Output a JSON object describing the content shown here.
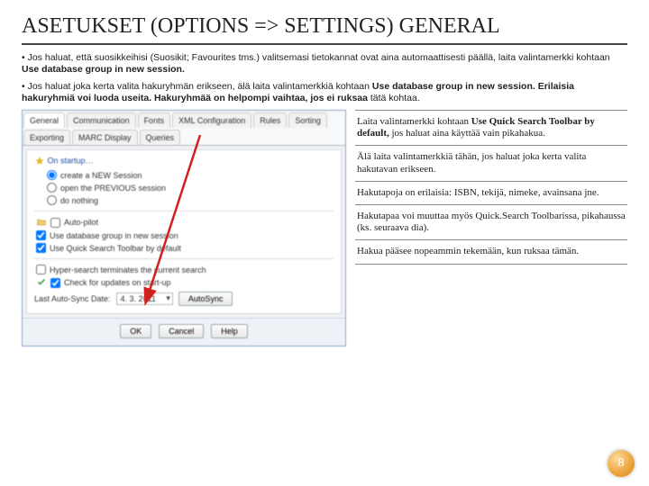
{
  "title": "ASETUKSET (OPTIONS => SETTINGS) GENERAL",
  "bullets": {
    "p1a": "• Jos haluat, että suosikkeihisi (Suosikit; Favourites tms.) valitsemasi tietokannat ovat aina automaattisesti päällä, laita valintamerkki kohtaan ",
    "p1b": "Use database group in new session.",
    "p2a": "• Jos haluat joka kerta valita hakuryhmän erikseen, älä laita valintamerkkiä kohtaan ",
    "p2b": "Use database group in new session. Erilaisia hakuryhmiä voi luoda useita. Hakuryhmää on helpompi vaihtaa, jos ei ruksaa ",
    "p2c": "tätä kohtaa."
  },
  "dialog": {
    "tabs": [
      "General",
      "Communication",
      "Fonts",
      "XML Configuration",
      "Rules",
      "Sorting",
      "Exporting",
      "MARC Display",
      "Queries"
    ],
    "group_startup": "On startup…",
    "radio_new": "create a NEW Session",
    "radio_prev": "open the PREVIOUS session",
    "radio_nothing": "do nothing",
    "chk_autopilot": "Auto-pilot",
    "chk_dbgroup": "Use database group in new session",
    "chk_quicksearch": "Use Quick Search Toolbar by default",
    "chk_hyper": "Hyper-search terminates the current search",
    "chk_updates": "Check for updates on start-up",
    "autosync_label": "Last Auto-Sync Date:",
    "autosync_date": "4. 3. 2011",
    "btn_autosync": "AutoSync",
    "btn_ok": "OK",
    "btn_cancel": "Cancel",
    "btn_help": "Help"
  },
  "notes": {
    "n1a": "Laita valintamerkki kohtaan ",
    "n1b": "Use Quick Search Toolbar by default,",
    "n1c": " jos haluat aina käyttää vain pikahakua.",
    "n2": "Älä laita valintamerkkiä tähän, jos haluat joka kerta valita hakutavan erikseen.",
    "n3": "Hakutapoja on erilaisia: ISBN, tekijä, nimeke, avainsana jne.",
    "n4": "Hakutapaa voi muuttaa myös Quick.Search Toolbarissa, pikahaussa (ks. seuraava dia).",
    "n5": "Hakua pääsee nopeammin tekemään, kun ruksaa tämän."
  },
  "page": "8"
}
